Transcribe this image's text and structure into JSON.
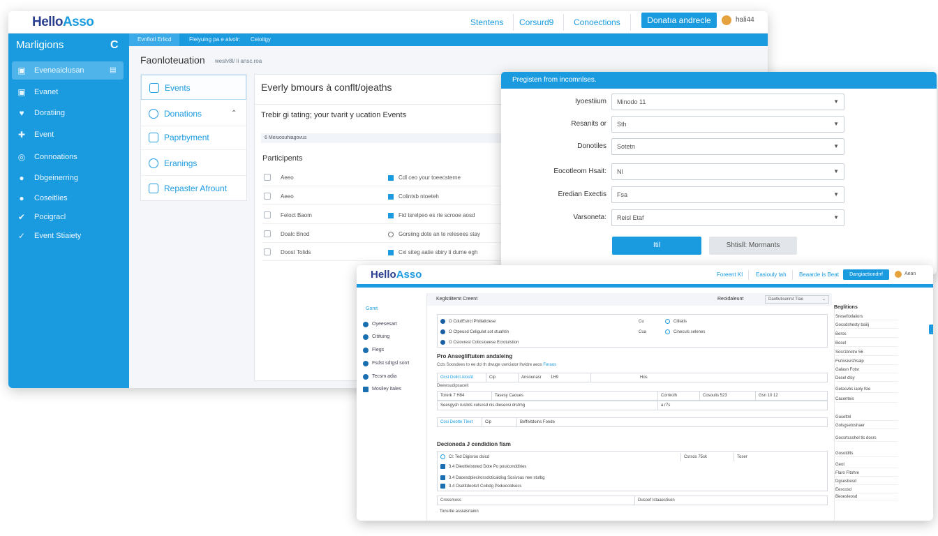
{
  "win1": {
    "logo": {
      "hello": "Hello",
      "asso": "Asso"
    },
    "nav": [
      "Stentens",
      "Corsurd9",
      "Conoections"
    ],
    "cta": "Donatıa andrecle",
    "user": "hali44",
    "sidebar": {
      "title": "Marligions",
      "items": [
        {
          "icon": "▣",
          "label": "Eveneaiclusan",
          "tail": "▤"
        },
        {
          "icon": "▣",
          "label": "Evanet"
        },
        {
          "icon": "♥",
          "label": "Doratiing"
        },
        {
          "icon": "✚",
          "label": "Event"
        },
        {
          "icon": "◎",
          "label": "Connoations"
        },
        {
          "icon": "●",
          "label": "Dbgeinerring"
        },
        {
          "icon": "●",
          "label": "Coseitlies"
        },
        {
          "icon": "✔",
          "label": "Pocigracl"
        },
        {
          "icon": "✓",
          "label": "Event Stiaiety"
        }
      ]
    },
    "subtabs": [
      "Evnfiotl Erlicd",
      "Fleiyuing pa e aivolr:",
      "Ceioitgy"
    ],
    "page": {
      "title": "Faonloteuation",
      "crumb": "weslv8l/ li ansc.roa"
    },
    "menu": [
      {
        "label": "Events"
      },
      {
        "label": "Donations",
        "chev": "⌃"
      },
      {
        "label": "Paprbyment"
      },
      {
        "label": "Eranings"
      },
      {
        "label": "Repaster Afrount"
      }
    ],
    "content": {
      "heading": "Everly bmours à conflt/ojeaths",
      "sub": "Trebir gi tating; your tvarit y ucation Events",
      "strip": "6 Meiuosuhiagovus",
      "participants": "Participents",
      "rows": [
        {
          "name": "Aeeo",
          "desc": "Cdl ceo your toeecsterne",
          "mark": "sq"
        },
        {
          "name": "Aeeo",
          "desc": "Colintsb ntoeteh",
          "mark": "sq"
        },
        {
          "name": "Feloct Baom",
          "desc": "Fid tsrelpeo es rle scrooe aosd",
          "mark": "sq"
        },
        {
          "name": "Doalc Bnod",
          "desc": "Gorsiing dote an te relesees stay",
          "mark": "ring"
        },
        {
          "name": "Doost Tolids",
          "desc": "Cxi siteg aatie sbiry ti dume egh",
          "mark": "sq"
        }
      ]
    }
  },
  "win2": {
    "header": "Pregisten from incomnlses.",
    "fields": [
      {
        "label": "Iyoestiium",
        "value": "Minodo 11"
      },
      {
        "label": "Resanits or",
        "value": "Sth"
      },
      {
        "label": "Donotiles",
        "value": "Sotetn"
      },
      {
        "label": "Eocotleom Hsait:",
        "value": "Nl"
      },
      {
        "label": "Eredian Exectis",
        "value": "Fsa"
      },
      {
        "label": "Varsoneta:",
        "value": "Reisl Etaf"
      }
    ],
    "primary": "Itil",
    "secondary": "Shtisll: Mormants"
  },
  "win3": {
    "logo": {
      "hello": "Hello",
      "asso": "Asso"
    },
    "nav": [
      "Foreent KI",
      "Easiouly tah",
      "Beaarde is Beat"
    ],
    "cta": "Dangiaetiondrrf",
    "user": "Aean",
    "sidebar": [
      "Gomt",
      "Oyeesesart",
      "Citituing",
      "Flegs",
      "Fsdst sdtgsl sorrt",
      "Tecsm adia",
      "Mosiley itales"
    ],
    "header": "Keglstiitemt Creent",
    "reg_label": "Reoidaleunt",
    "reg_select": "Daotlutisenrst Tlae",
    "radios": [
      {
        "label": "O CdutEstrcl Phillaticlese",
        "c2": "Cu",
        "c3": "Cliliatls"
      },
      {
        "label": "O Ctpeusd Celigulot sot stuahtin",
        "c2": "Cua",
        "c3": "Cineculs selenes"
      },
      {
        "label": "O Cstovrest Colicsioeese Ecrotulstion"
      }
    ],
    "section1": "Pro  Ansegliftutem andaleing",
    "note1": "Ccts Soosdees to ee dcl th dwuge uwrciator lhvidre aeos",
    "note1_link": "Feraos",
    "row1": {
      "a": "Ocst Dolict Alosfd",
      "b": "Cip",
      "c": "Ansounasr",
      "d": "1H9",
      "e": "Hos"
    },
    "note2": "Deewsudipsaceit",
    "row2": {
      "a": "Torerk 7 H84",
      "b": "Tasesy Caoues",
      "c": "Corrirolh",
      "d": "Cosoulis 523",
      "e": "Gsn 10 12"
    },
    "row3": "Seesgysh ruslrds colsosd nis dieseosi drstmg",
    "row3b": "a r7s",
    "row4": {
      "a": "Cosi Deotte Tleet",
      "b": "Cip",
      "c": "Beffeitdoins Fonde"
    },
    "section2": "Decioneda J cendidion fiam",
    "list": [
      {
        "label": "Cl: Ted Digisroo dsicd",
        "c2": "Csrsos 75sk",
        "c3": "Toser",
        "mark": "ring"
      },
      {
        "label": "3.4 Dieoltleistoted Dote Po pouiconddiries",
        "mark": "sq"
      },
      {
        "label": "3.4 Daoesdpiecirossdcticaldisg Sosivsas nee stulbg",
        "mark": "sq"
      },
      {
        "label": "3.4 Osetitdeolsrl Coibdg Peduicoldsecs",
        "mark": "sq"
      }
    ],
    "foot": {
      "a": "Crossmoss",
      "b": "Dusoef Istaaestison"
    },
    "footnote": "Tonsrtie assialsrlainn",
    "rcol_title": "Beglitions",
    "rcol": [
      "Sresefiotlaiiors",
      "Gocsdshesty bsiilj",
      "Beros",
      "Bosel",
      "Sosr1brotre 56",
      "Fsrtosisrsfrsalp",
      "Galasn Fotsr",
      "Desel dlsy",
      "Getasvbs iaoly fsle",
      "Cacenteis",
      "Gusettnl",
      "Golsgsetoshaer",
      "Gocsrtcsshel tlc dosrs",
      "Gosotdlts",
      "Geot",
      "Flaro Fltohre",
      "Dgsesbesd",
      "Eescosd",
      "Beoesleosd"
    ]
  }
}
